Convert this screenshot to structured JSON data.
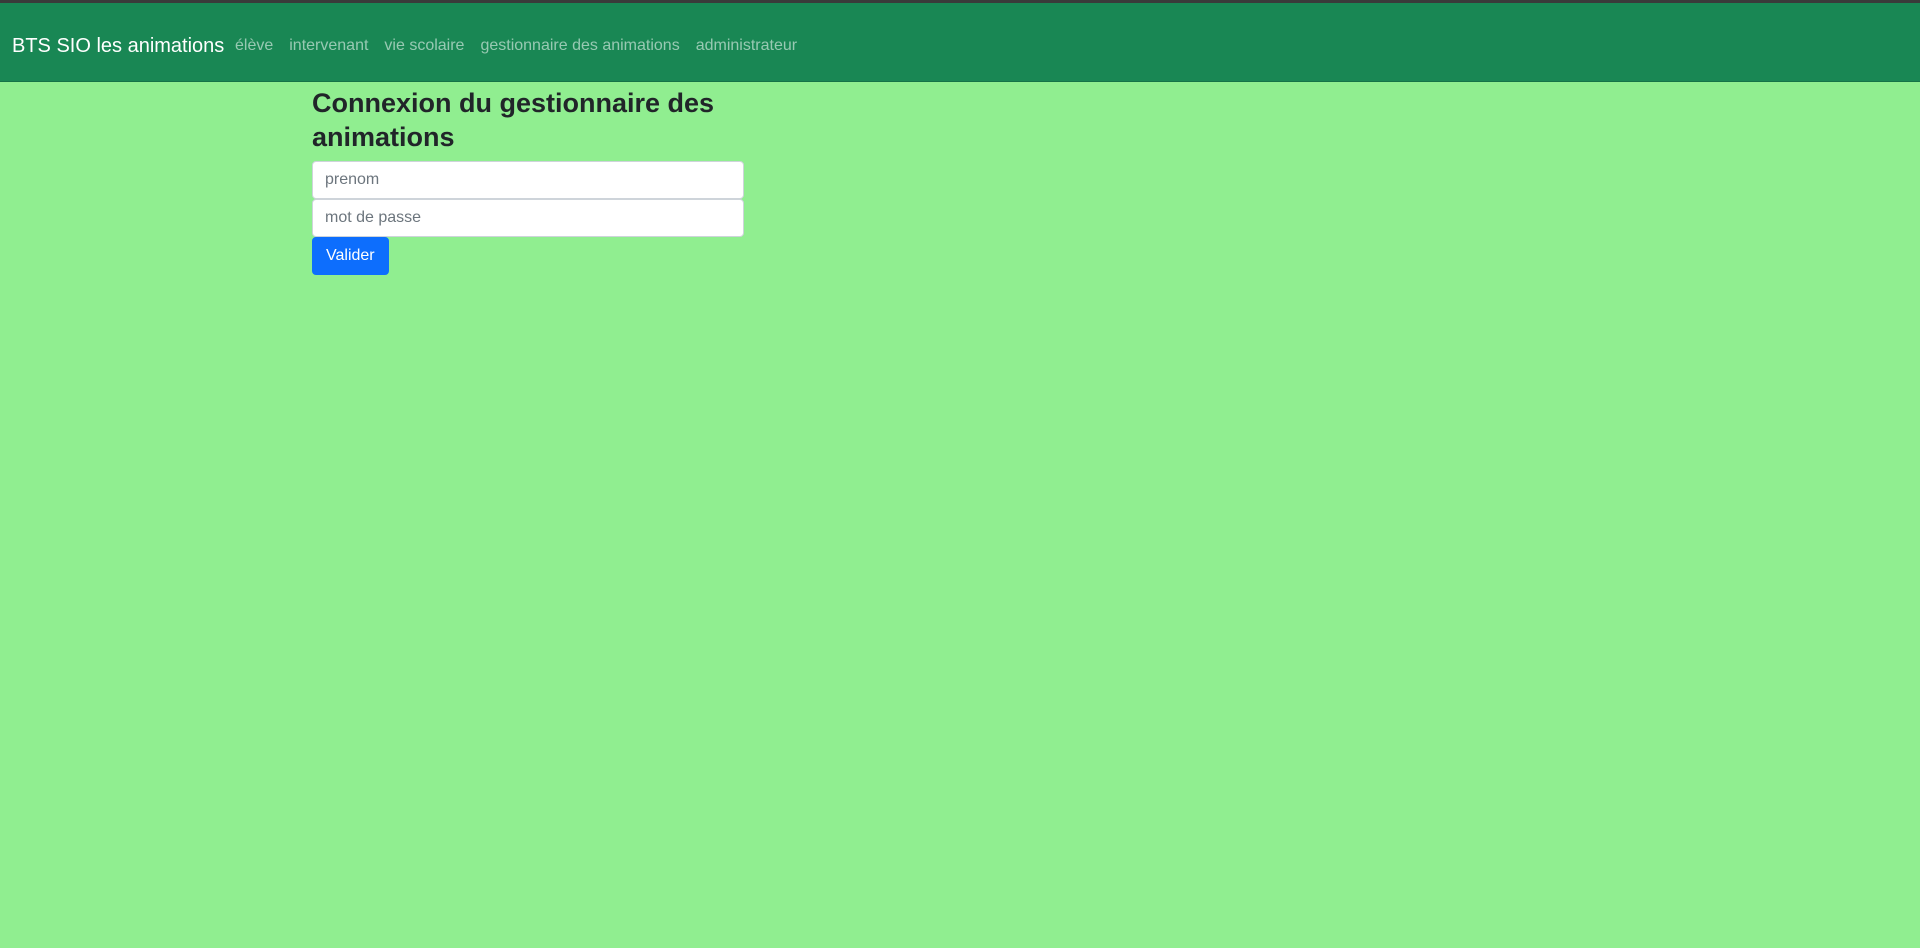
{
  "navbar": {
    "brand": "BTS SIO les animations",
    "links": [
      {
        "label": "élève"
      },
      {
        "label": "intervenant"
      },
      {
        "label": "vie scolaire"
      },
      {
        "label": "gestionnaire des animations"
      },
      {
        "label": "administrateur"
      }
    ]
  },
  "form": {
    "title": "Connexion du gestionnaire des animations",
    "firstname_placeholder": "prenom",
    "password_placeholder": "mot de passe",
    "submit_label": "Valider"
  },
  "colors": {
    "page_background": "#90ee90",
    "navbar_background": "#198754",
    "button_primary": "#0d6efd"
  }
}
